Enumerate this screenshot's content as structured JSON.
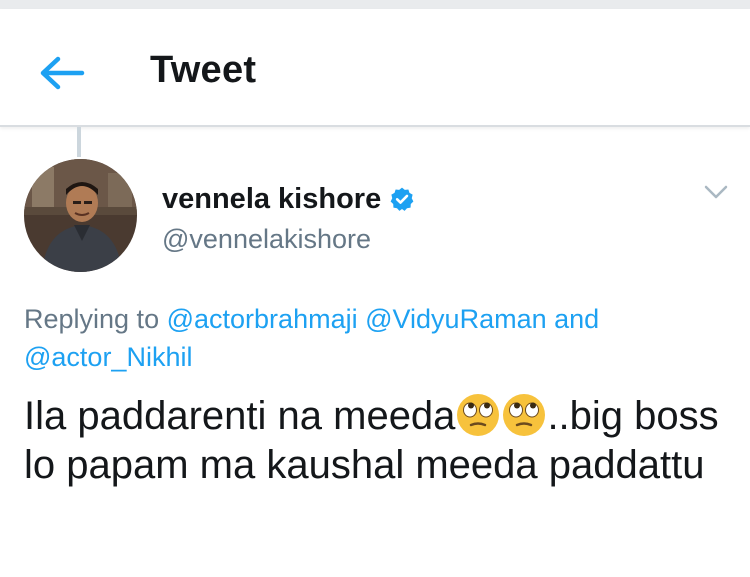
{
  "header": {
    "title": "Tweet",
    "back_icon": "arrow-left-icon",
    "accent_color": "#1da1f2"
  },
  "tweet": {
    "author_name": "vennela kishore",
    "author_handle": "@vennelakishore",
    "verified": true,
    "verified_icon": "verified-badge-icon",
    "menu_icon": "chevron-down-icon",
    "reply_prefix": "Replying to",
    "reply_users": [
      "@actorbrahmaji",
      "@VidyuRaman",
      "@actor_Nikhil"
    ],
    "reply_conjunction": "and",
    "text_part1": "Ila paddarenti na meeda",
    "emoji_name": "face-with-rolling-eyes",
    "text_part2": "..big boss lo papam ma kaushal meeda paddattu"
  }
}
